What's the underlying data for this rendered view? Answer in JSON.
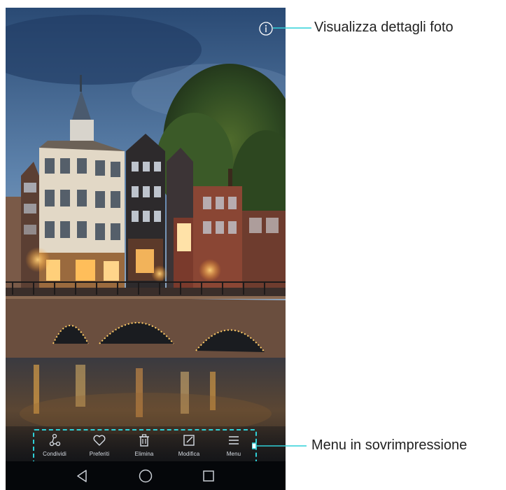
{
  "callouts": {
    "details": "Visualizza dettagli foto",
    "menu": "Menu in sovrimpressione"
  },
  "toolbar": {
    "share_label": "Condividi",
    "favorite_label": "Preferiti",
    "delete_label": "Elimina",
    "edit_label": "Modifica",
    "menu_label": "Menu"
  },
  "icons": {
    "details": "info-icon",
    "share": "share-icon",
    "favorite": "heart-icon",
    "delete": "trash-icon",
    "edit": "edit-icon",
    "menu": "hamburger-menu-icon",
    "nav_back": "back-triangle-icon",
    "nav_home": "home-circle-icon",
    "nav_recents": "recents-square-icon"
  },
  "colors": {
    "highlight": "#2fd0d8",
    "toolbar_text": "#d8dee6",
    "navbar": "#05070a"
  }
}
